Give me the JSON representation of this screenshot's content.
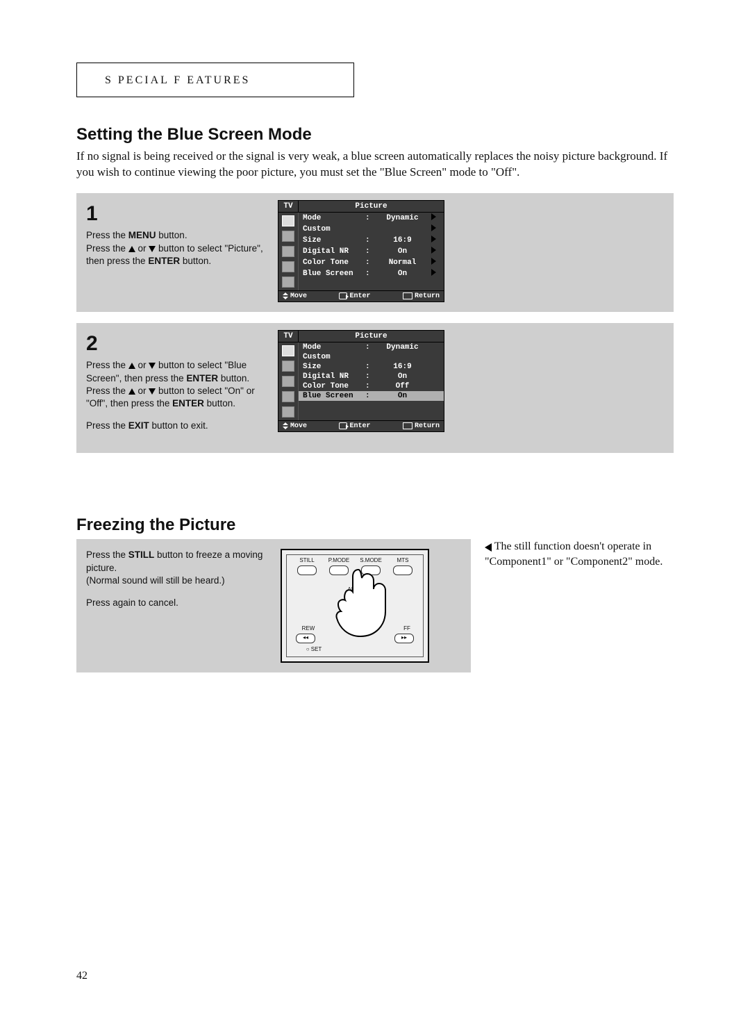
{
  "header": "S PECIAL  F EATURES",
  "section1": {
    "title": "Setting the Blue Screen Mode",
    "intro": "If no signal is being received or the signal is very weak, a blue screen automatically replaces the noisy picture background. If you wish to continue viewing the poor picture, you must set the \"Blue Screen\" mode to \"Off\"."
  },
  "step1": {
    "num": "1",
    "line1a": "Press the ",
    "line1b": "MENU",
    "line1c": " button.",
    "line2a": "Press the ",
    "line2b": " or ",
    "line2c": " button to select \"Picture\", then press the ",
    "line2d": "ENTER",
    "line2e": " button."
  },
  "step2": {
    "num": "2",
    "l1a": "Press the ",
    "l1b": " or ",
    "l1c": " button to select \"Blue Screen\", then press the ",
    "l1d": "ENTER",
    "l1e": " button.",
    "l2a": "Press the ",
    "l2b": " or ",
    "l2c": " button to select \"On\" or \"Off\", then press the ",
    "l2d": "ENTER",
    "l2e": " button.",
    "l3a": "Press the ",
    "l3b": "EXIT",
    "l3c": " button to exit."
  },
  "osd1": {
    "tv": "TV",
    "title": "Picture",
    "rows": [
      {
        "k": "Mode",
        "c": ":",
        "v": "Dynamic",
        "arr": true,
        "sel": false
      },
      {
        "k": "Custom",
        "c": "",
        "v": "",
        "arr": true,
        "sel": false
      },
      {
        "k": "Size",
        "c": ":",
        "v": "16:9",
        "arr": true,
        "sel": false
      },
      {
        "k": "Digital NR",
        "c": ":",
        "v": "On",
        "arr": true,
        "sel": false
      },
      {
        "k": "Color Tone",
        "c": ":",
        "v": "Normal",
        "arr": true,
        "sel": false
      },
      {
        "k": "Blue Screen",
        "c": ":",
        "v": "On",
        "arr": true,
        "sel": false
      }
    ],
    "foot_move": "Move",
    "foot_enter": "Enter",
    "foot_return": "Return"
  },
  "osd2": {
    "tv": "TV",
    "title": "Picture",
    "rows": [
      {
        "k": "Mode",
        "c": ":",
        "v": "Dynamic",
        "arr": false,
        "sel": false
      },
      {
        "k": "Custom",
        "c": "",
        "v": "",
        "arr": false,
        "sel": false
      },
      {
        "k": "Size",
        "c": ":",
        "v": "16:9",
        "arr": false,
        "sel": false
      },
      {
        "k": "Digital NR",
        "c": ":",
        "v": "On",
        "arr": false,
        "sel": false
      },
      {
        "k": "Color Tone",
        "c": ":",
        "v": "Off",
        "arr": false,
        "sel": false
      },
      {
        "k": "Blue Screen",
        "c": ":",
        "v": "On",
        "arr": false,
        "sel": true
      }
    ],
    "foot_move": "Move",
    "foot_enter": "Enter",
    "foot_return": "Return"
  },
  "section2": {
    "title": "Freezing the Picture"
  },
  "freeze": {
    "l1a": "Press the ",
    "l1b": "STILL",
    "l1c": " button to freeze a moving picture.",
    "l2": "(Normal sound will still be heard.)",
    "l3": "Press again to cancel."
  },
  "remote": {
    "b_still": "STILL",
    "b_pmode": "P.MODE",
    "b_smode": "S.MODE",
    "b_mts": "MTS",
    "b_add": "ADD",
    "b_rew": "REW",
    "b_ff": "FF",
    "b_set": "SET",
    "rew_sym": "◂◂",
    "ff_sym": "▸▸"
  },
  "note": " The still function doesn't operate in \"Component1\" or \"Component2\" mode.",
  "page_number": "42"
}
